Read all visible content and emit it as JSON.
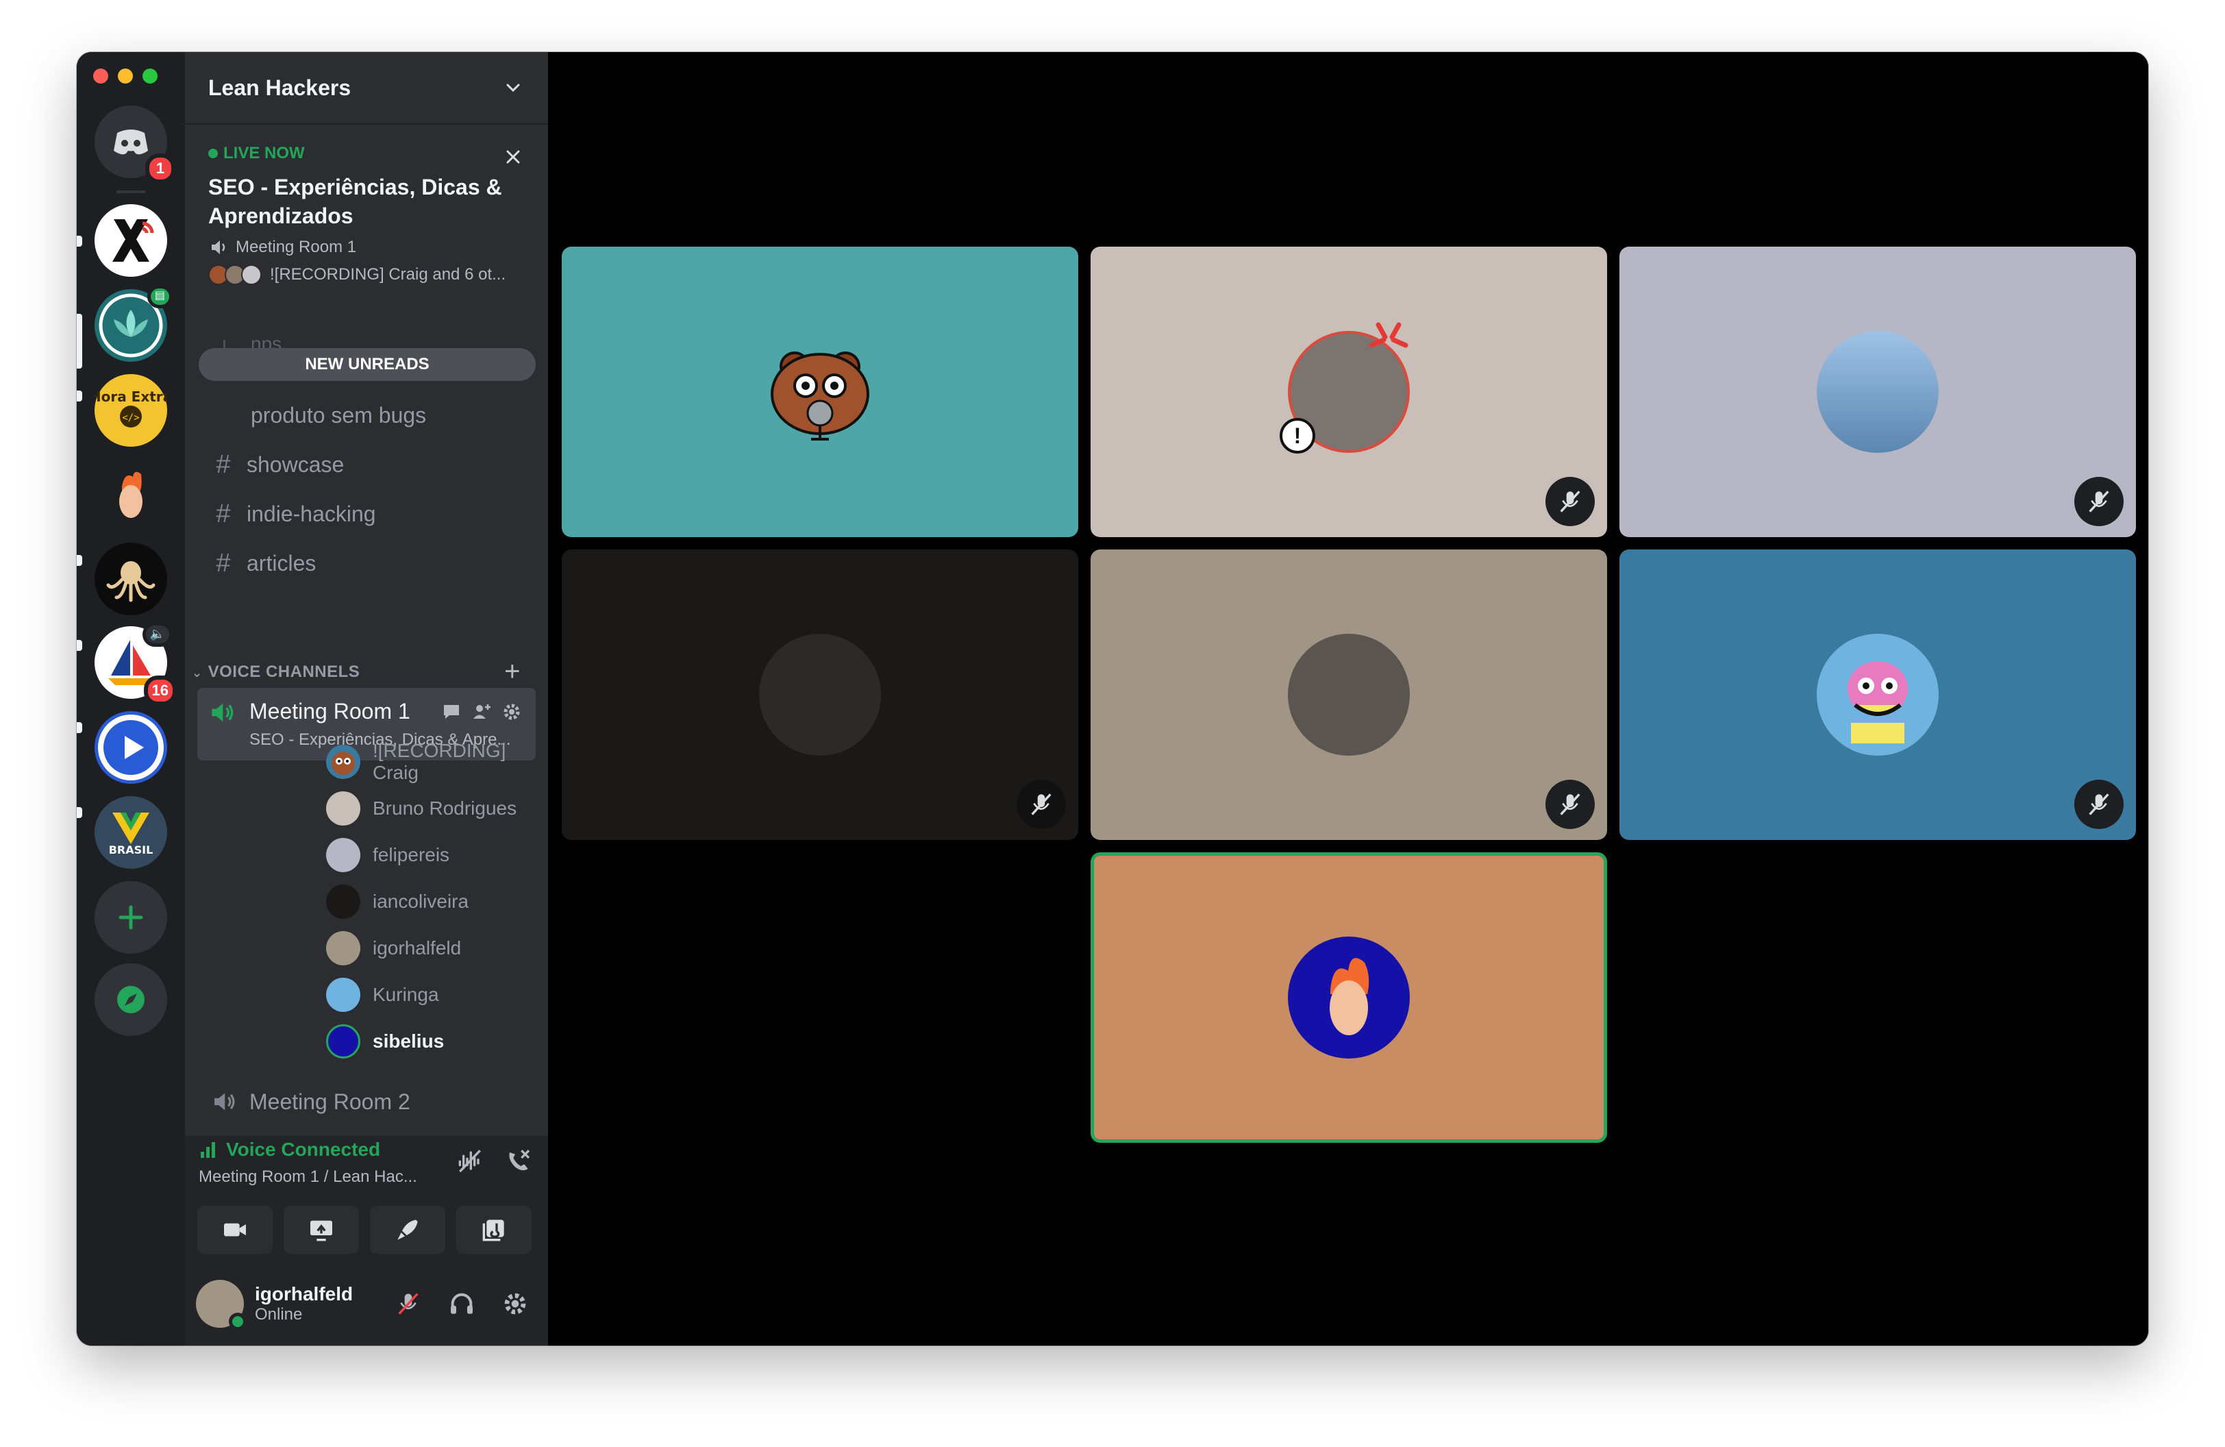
{
  "server": {
    "name": "Lean Hackers",
    "home_badge": "1",
    "sailboat_badge": "16"
  },
  "live": {
    "label": "LIVE NOW",
    "title": "SEO - Experiências, Dicas & Aprendizados",
    "room": "Meeting Room 1",
    "participants": "![RECORDING] Craig and 6 ot..."
  },
  "channels": {
    "ghost": "nps",
    "new_unreads": "NEW UNREADS",
    "thread": "produto sem bugs",
    "items": [
      "showcase",
      "indie-hacking",
      "articles"
    ]
  },
  "voice": {
    "category": "VOICE CHANNELS",
    "room1": {
      "name": "Meeting Room 1",
      "subtitle": "SEO - Experiências, Dicas & Apre..."
    },
    "users": [
      "![RECORDING] Craig",
      "Bruno Rodrigues",
      "felipereis",
      "iancoliveira",
      "igorhalfeld",
      "Kuringa",
      "sibelius"
    ],
    "room2": "Meeting Room 2"
  },
  "connection": {
    "status": "Voice Connected",
    "location": "Meeting Room 1 / Lean Hac..."
  },
  "user": {
    "name": "igorhalfeld",
    "status": "Online"
  },
  "colors": {
    "accent_green": "#23a55a",
    "tile_teal": "#4ea6a6",
    "tile_beige": "#c9bfb8",
    "tile_lavender": "#b7b6c5",
    "tile_dark": "#1a1917",
    "tile_taupe": "#a19685",
    "tile_blue": "#3a7a9e",
    "tile_orange": "#c98d64"
  }
}
